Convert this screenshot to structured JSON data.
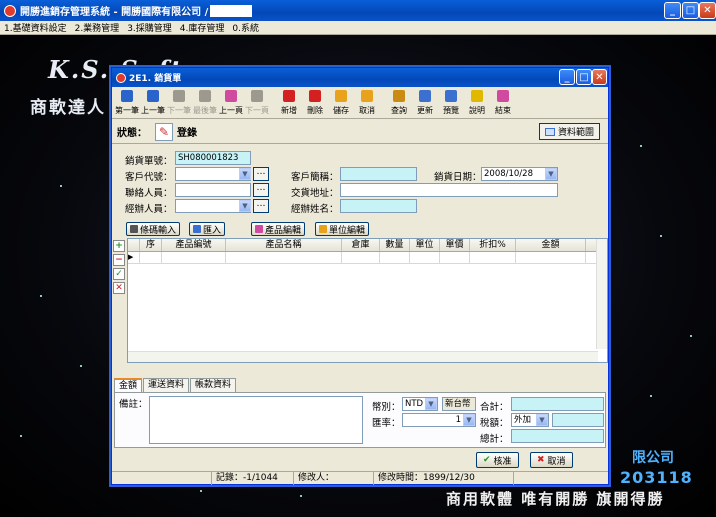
{
  "main_window": {
    "title": "開勝進銷存管理系統 - 開勝國際有限公司 /",
    "menu": [
      "1.基礎資料設定",
      "2.業務管理",
      "3.採購管理",
      "4.庫存管理",
      "0.系統"
    ]
  },
  "background": {
    "brand_en": "K.S. Software",
    "brand_cn": "商軟達人",
    "company": "限公司",
    "phone": "203118",
    "slogan": "商用軟體 唯有開勝 旗開得勝"
  },
  "child_window": {
    "title": "2E1. 銷貨單",
    "toolbar": [
      {
        "label": "第一筆",
        "icon": "first-record-icon",
        "color": "#2a63c9",
        "enabled": true
      },
      {
        "label": "上一筆",
        "icon": "prev-record-icon",
        "color": "#2a63c9",
        "enabled": true
      },
      {
        "label": "下一筆",
        "icon": "next-record-icon",
        "color": "#9c9a8f",
        "enabled": false
      },
      {
        "label": "最後筆",
        "icon": "last-record-icon",
        "color": "#9c9a8f",
        "enabled": false
      },
      {
        "label": "上一頁",
        "icon": "prev-page-icon",
        "color": "#d04aa0",
        "enabled": true
      },
      {
        "label": "下一頁",
        "icon": "next-page-icon",
        "color": "#9c9a8f",
        "enabled": false
      },
      {
        "label": "新增",
        "icon": "add-icon",
        "color": "#d32020",
        "enabled": true
      },
      {
        "label": "刪除",
        "icon": "delete-icon",
        "color": "#d32020",
        "enabled": true
      },
      {
        "label": "儲存",
        "icon": "save-icon",
        "color": "#e8a21c",
        "enabled": true
      },
      {
        "label": "取消",
        "icon": "cancel-icon",
        "color": "#e8a21c",
        "enabled": true
      },
      {
        "label": "查詢",
        "icon": "search-icon",
        "color": "#c98b12",
        "enabled": true
      },
      {
        "label": "更新",
        "icon": "refresh-icon",
        "color": "#3b6fd0",
        "enabled": true
      },
      {
        "label": "預覽",
        "icon": "preview-icon",
        "color": "#3b6fd0",
        "enabled": true
      },
      {
        "label": "說明",
        "icon": "help-icon",
        "color": "#e0b800",
        "enabled": true
      },
      {
        "label": "結束",
        "icon": "exit-icon",
        "color": "#d04aa0",
        "enabled": true
      }
    ],
    "status_label": "狀態：",
    "status_value": "登錄",
    "range_button": "資料範圍",
    "form": {
      "order_no_label": "銷貨單號：",
      "order_no": "SH080001823",
      "customer_code_label": "客戶代號：",
      "customer_name_label": "客戶簡稱：",
      "sales_date_label": "銷貨日期：",
      "sales_date": "2008/10/28",
      "contact_label": "聯絡人員：",
      "address_label": "交貨地址：",
      "handler_label": "經辦人員：",
      "handler_name_label": "經辦姓名："
    },
    "grid_buttons": [
      "條碼輸入",
      "匯入",
      "產品編輯",
      "單位編輯"
    ],
    "grid_columns": [
      "序",
      "產品編號",
      "產品名稱",
      "倉庫",
      "數量",
      "單位",
      "單價",
      "折扣%",
      "金額"
    ],
    "tabs": [
      "金額",
      "運送資料",
      "帳款資料"
    ],
    "amount": {
      "remark_label": "備註：",
      "currency_label": "幣別：",
      "currency": "NTD",
      "currency_name": "新台幣",
      "total_label": "合計：",
      "rate_label": "匯率：",
      "rate": "1",
      "tax_label": "稅額：",
      "tax_mode": "外加",
      "grand_total_label": "總計："
    },
    "buttons": {
      "approve": "核准",
      "cancel": "取消"
    },
    "statusbar": {
      "records": "記錄：-1/1044",
      "modifier": "修改人：",
      "modified_time": "修改時間：1899/12/30"
    }
  }
}
